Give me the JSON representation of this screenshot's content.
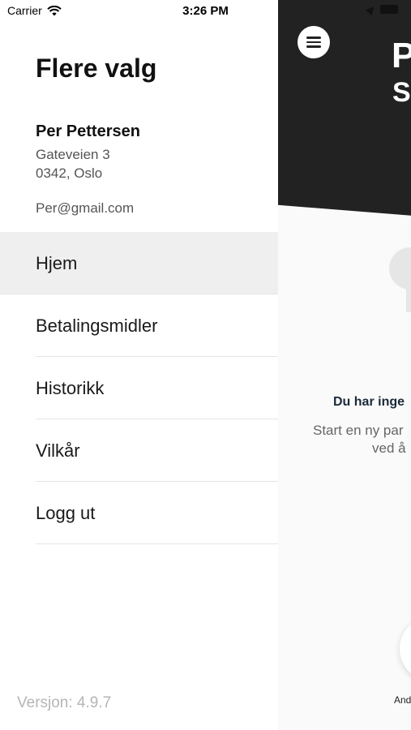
{
  "status_bar": {
    "carrier": "Carrier",
    "time": "3:26 PM"
  },
  "drawer": {
    "title": "Flere valg",
    "user": {
      "name": "Per Pettersen",
      "street": "Gateveien 3",
      "city": "0342, Oslo",
      "email": "Per@gmail.com"
    },
    "menu": [
      {
        "label": "Hjem",
        "active": true
      },
      {
        "label": "Betalingsmidler",
        "active": false
      },
      {
        "label": "Historikk",
        "active": false
      },
      {
        "label": "Vilkår",
        "active": false
      },
      {
        "label": "Logg ut",
        "active": false
      }
    ],
    "version": "Versjon: 4.9.7"
  },
  "main": {
    "hero_title": "P",
    "hero_subtitle": "S",
    "empty_title": "Du har inge",
    "empty_text_line1": "Start en ny par",
    "empty_text_line2": "ved å",
    "fab_label": "And"
  }
}
